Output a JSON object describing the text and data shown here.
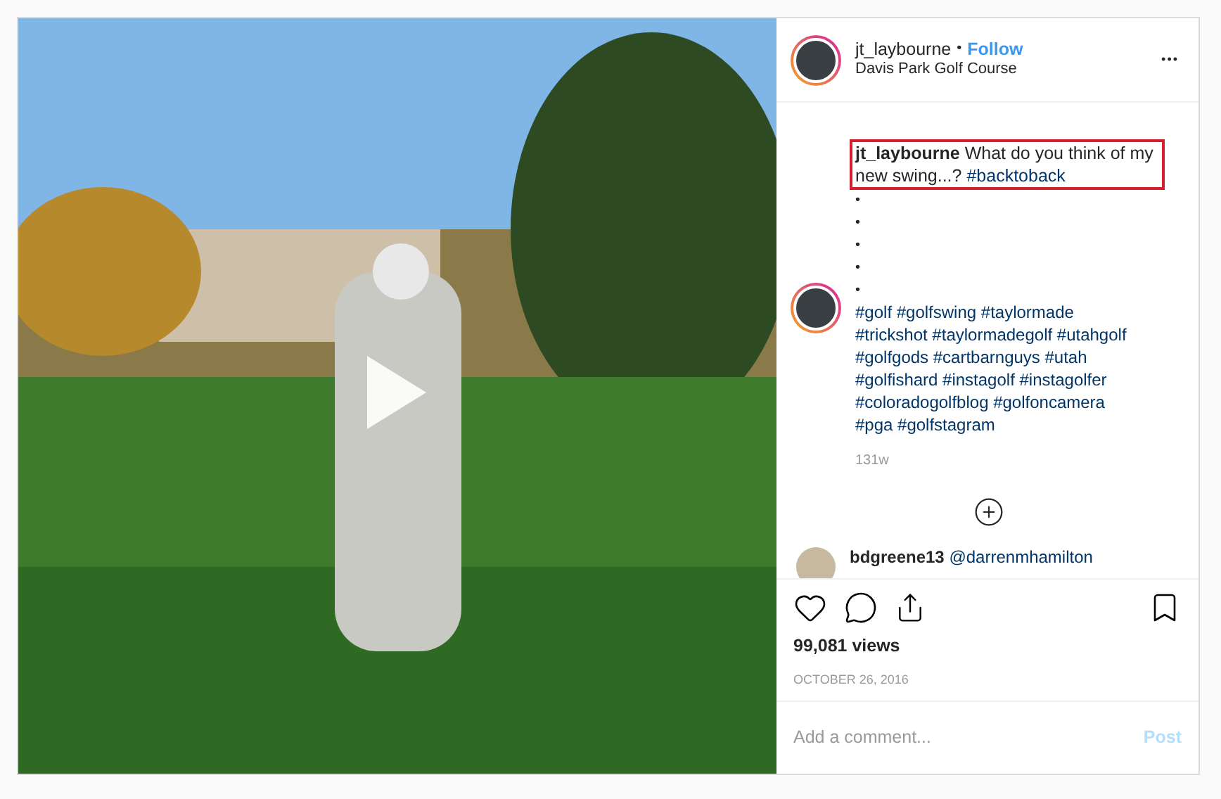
{
  "post": {
    "username": "jt_laybourne",
    "separator": "•",
    "follow": "Follow",
    "location": "Davis Park Golf Course",
    "more": "•••",
    "caption": {
      "username": "jt_laybourne",
      "text": "What do you think of my new swing...?",
      "hashtag": "#backtoback",
      "highlighted": true
    },
    "bullets": [
      "•",
      "•",
      "•",
      "•",
      "•"
    ],
    "hashtag_lines": [
      "#golf #golfswing #taylormade",
      "#trickshot #taylormadegolf #utahgolf",
      "#golfgods #cartbarnguys #utah",
      "#golfishard #instagolf #instagolfer",
      "#coloradogolfblog #golfoncamera",
      "#pga #golfstagram"
    ],
    "age": "131w",
    "comment": {
      "username": "bdgreene13",
      "mention": "@darrenmhamilton"
    },
    "views": "99,081 views",
    "date": "OCTOBER 26, 2016",
    "comment_field": {
      "placeholder": "Add a comment...",
      "post": "Post"
    }
  }
}
